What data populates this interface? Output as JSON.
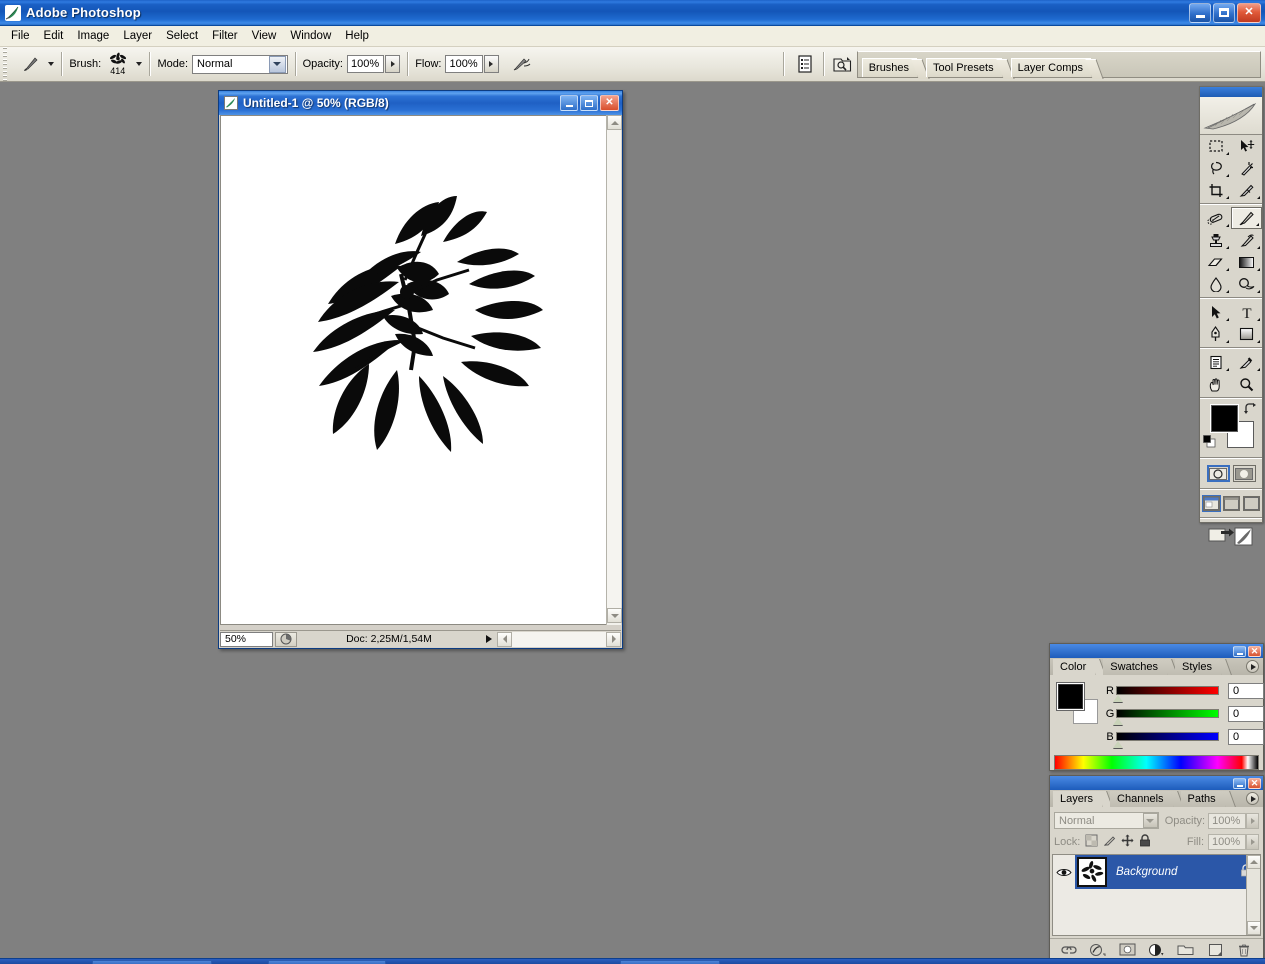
{
  "app": {
    "title": "Adobe Photoshop",
    "logo_icon": "photoshop-feather-icon",
    "window_buttons": {
      "minimize": "minimize-icon",
      "maximize": "maximize-icon",
      "close": "close-icon"
    }
  },
  "menubar": {
    "items": [
      {
        "label": "File"
      },
      {
        "label": "Edit"
      },
      {
        "label": "Image"
      },
      {
        "label": "Layer"
      },
      {
        "label": "Select"
      },
      {
        "label": "Filter"
      },
      {
        "label": "View"
      },
      {
        "label": "Window"
      },
      {
        "label": "Help"
      }
    ]
  },
  "options_bar": {
    "tool_icon": "paintbrush-icon",
    "brush_label": "Brush:",
    "brush_size": "414",
    "brush_preview_icon": "leaf-brush-tip-icon",
    "mode_label": "Mode:",
    "mode_value": "Normal",
    "opacity_label": "Opacity:",
    "opacity_value": "100%",
    "flow_label": "Flow:",
    "flow_value": "100%",
    "airbrush_icon": "airbrush-icon",
    "brushes_toggle_icon": "brushes-palette-toggle-icon",
    "file_browser_icon": "file-browser-icon",
    "palette_well": {
      "tabs": [
        {
          "label": "Brushes"
        },
        {
          "label": "Tool Presets"
        },
        {
          "label": "Layer Comps"
        }
      ]
    }
  },
  "document": {
    "icon": "document-icon",
    "title": "Untitled-1 @ 50% (RGB/8)",
    "window_buttons": {
      "minimize": "minimize-icon",
      "maximize": "maximize-icon",
      "close": "close-icon"
    },
    "canvas": {
      "background_color": "#ffffff",
      "artwork": "black-compound-leaf-silhouette",
      "artwork_color": "#000000"
    },
    "statusbar": {
      "zoom": "50%",
      "info_icon": "document-profile-icon",
      "doc_size": "Doc: 2,25M/1,54M",
      "more_arrow_icon": "status-more-arrow-icon"
    },
    "scrollbars": {
      "vertical_up_icon": "scroll-up-arrow-icon",
      "vertical_down_icon": "scroll-down-arrow-icon",
      "horizontal_left_icon": "scroll-left-arrow-icon",
      "horizontal_right_icon": "scroll-right-arrow-icon"
    }
  },
  "toolbox": {
    "logo_icon": "photoshop-feather-logo-icon",
    "tools": [
      {
        "name": "rectangular-marquee-tool-icon",
        "selected": false,
        "has_flyout": true
      },
      {
        "name": "move-tool-icon",
        "selected": false,
        "has_flyout": false
      },
      {
        "name": "lasso-tool-icon",
        "selected": false,
        "has_flyout": true
      },
      {
        "name": "magic-wand-tool-icon",
        "selected": false,
        "has_flyout": false
      },
      {
        "name": "crop-tool-icon",
        "selected": false,
        "has_flyout": false
      },
      {
        "name": "slice-tool-icon",
        "selected": false,
        "has_flyout": true
      },
      {
        "name": "healing-brush-tool-icon",
        "selected": false,
        "has_flyout": true
      },
      {
        "name": "brush-tool-icon",
        "selected": true,
        "has_flyout": true
      },
      {
        "name": "clone-stamp-tool-icon",
        "selected": false,
        "has_flyout": true
      },
      {
        "name": "history-brush-tool-icon",
        "selected": false,
        "has_flyout": true
      },
      {
        "name": "eraser-tool-icon",
        "selected": false,
        "has_flyout": true
      },
      {
        "name": "gradient-tool-icon",
        "selected": false,
        "has_flyout": true
      },
      {
        "name": "blur-tool-icon",
        "selected": false,
        "has_flyout": true
      },
      {
        "name": "dodge-tool-icon",
        "selected": false,
        "has_flyout": true
      },
      {
        "name": "path-selection-tool-icon",
        "selected": false,
        "has_flyout": true
      },
      {
        "name": "type-tool-icon",
        "selected": false,
        "has_flyout": true
      },
      {
        "name": "pen-tool-icon",
        "selected": false,
        "has_flyout": true
      },
      {
        "name": "rectangle-shape-tool-icon",
        "selected": false,
        "has_flyout": true
      },
      {
        "name": "notes-tool-icon",
        "selected": false,
        "has_flyout": true
      },
      {
        "name": "eyedropper-tool-icon",
        "selected": false,
        "has_flyout": true
      },
      {
        "name": "hand-tool-icon",
        "selected": false,
        "has_flyout": false
      },
      {
        "name": "zoom-tool-icon",
        "selected": false,
        "has_flyout": false
      }
    ],
    "foreground_color": "#000000",
    "background_color": "#ffffff",
    "swap_colors_icon": "swap-colors-icon",
    "default_colors_icon": "default-colors-icon",
    "quickmask": [
      {
        "name": "standard-mode-icon",
        "selected": true
      },
      {
        "name": "quick-mask-mode-icon",
        "selected": false
      }
    ],
    "screen_modes": [
      {
        "name": "standard-screen-mode-icon",
        "selected": true
      },
      {
        "name": "full-screen-with-menubar-icon",
        "selected": false
      },
      {
        "name": "full-screen-mode-icon",
        "selected": false
      }
    ],
    "jump_to_imageready_icon": "jump-to-imageready-icon"
  },
  "color_palette": {
    "tabs": [
      {
        "label": "Color",
        "active": true
      },
      {
        "label": "Swatches",
        "active": false
      },
      {
        "label": "Styles",
        "active": false
      }
    ],
    "menu_icon": "palette-menu-icon",
    "foreground_color": "#000000",
    "background_color": "#ffffff",
    "channels": [
      {
        "label": "R",
        "value": "0",
        "gradient_to": "#ff0000"
      },
      {
        "label": "G",
        "value": "0",
        "gradient_to": "#00ff00"
      },
      {
        "label": "B",
        "value": "0",
        "gradient_to": "#0000ff"
      }
    ],
    "spectrum_label": "color-ramp"
  },
  "layers_palette": {
    "tabs": [
      {
        "label": "Layers",
        "active": true
      },
      {
        "label": "Channels",
        "active": false
      },
      {
        "label": "Paths",
        "active": false
      }
    ],
    "menu_icon": "palette-menu-icon",
    "blend_mode": "Normal",
    "opacity_label": "Opacity:",
    "opacity_value": "100%",
    "lock_label": "Lock:",
    "lock_icons": [
      "lock-transparency-icon",
      "lock-image-pixels-icon",
      "lock-position-icon",
      "lock-all-icon"
    ],
    "fill_label": "Fill:",
    "fill_value": "100%",
    "layers": [
      {
        "name": "Background",
        "visible": true,
        "locked": true,
        "selected": true,
        "eye_icon": "eye-visibility-icon",
        "lock_icon": "lock-icon",
        "thumbnail": "leaf-thumbnail"
      }
    ],
    "footer_buttons": [
      "link-layers-icon",
      "layer-style-fx-icon",
      "add-layer-mask-icon",
      "new-adjustment-layer-icon",
      "new-group-icon",
      "new-layer-icon",
      "delete-layer-icon"
    ]
  },
  "workspace": {
    "background_color": "#808080"
  }
}
